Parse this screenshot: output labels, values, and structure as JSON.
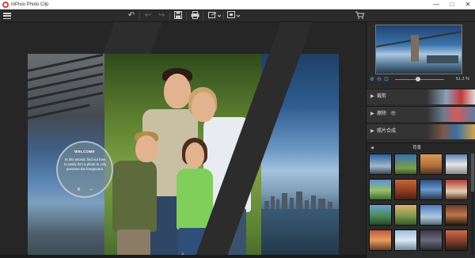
{
  "window": {
    "title": "InPixio Photo Clip",
    "controls": [
      "—",
      "□",
      "✕"
    ]
  },
  "toolbar": {
    "icons": [
      "menu-icon",
      "undo-all-icon",
      "undo-icon",
      "redo-icon",
      "save-icon",
      "print-icon",
      "export-icon",
      "resize-icon",
      "cart-icon"
    ]
  },
  "welcome": {
    "title": "WELCOME",
    "body": "In this tutorial, find out how to easily trim a photo to only preserve the foreground.",
    "close": "✕",
    "next": "→"
  },
  "navigator": {
    "zoom_value": "51.3 %"
  },
  "sections": [
    {
      "label": "裁剪",
      "eye": false
    },
    {
      "label": "擦除",
      "eye": true
    },
    {
      "label": "照片合成",
      "eye": false
    }
  ],
  "backgrounds": {
    "label": "背景",
    "thumb_count": 20
  },
  "colors": {
    "accent_blue": "#5aa0e0",
    "app_red": "#d7412e"
  }
}
